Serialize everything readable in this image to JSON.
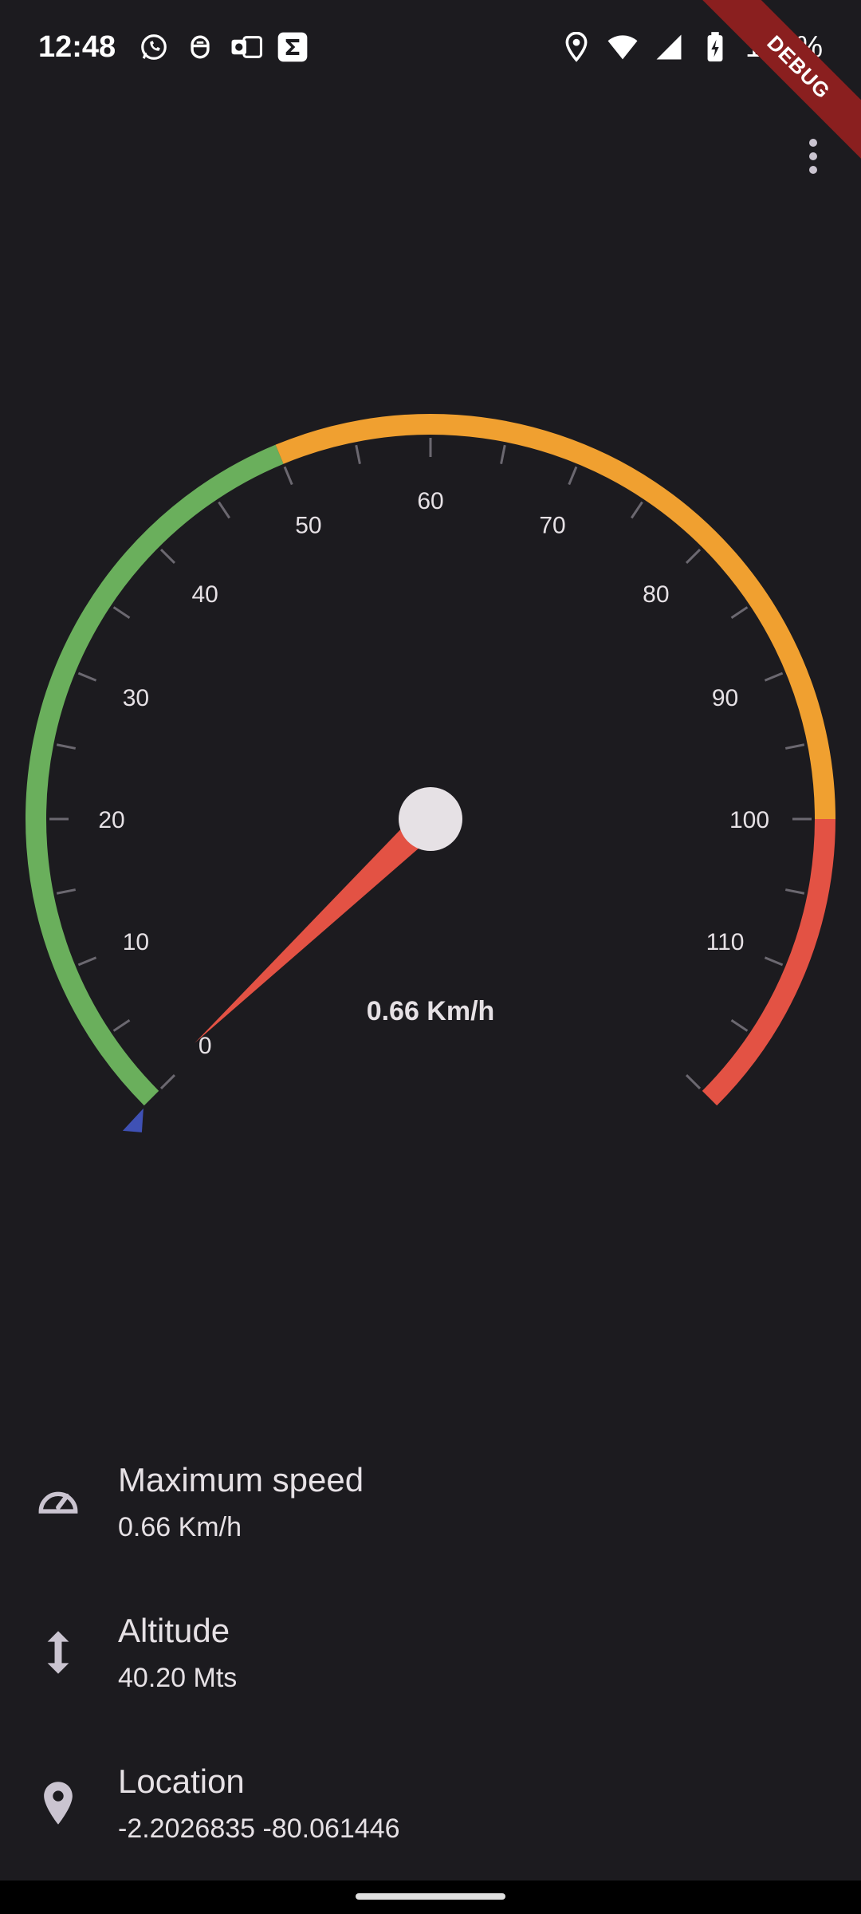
{
  "status_bar": {
    "time": "12:48",
    "battery": "100%",
    "left_icons": [
      "whatsapp-icon",
      "bug-icon",
      "vpn-icon",
      "sigma-icon"
    ],
    "right_icons": [
      "location-icon",
      "wifi-icon",
      "signal-icon",
      "battery-charging-icon"
    ]
  },
  "debug_banner": "DEBUG",
  "speedometer": {
    "min": 0,
    "max": 120,
    "value": 0.66,
    "readout": "0.66 Km/h",
    "tick_labels": [
      "0",
      "10",
      "20",
      "30",
      "40",
      "50",
      "60",
      "70",
      "80",
      "90",
      "100",
      "110"
    ],
    "ranges": [
      {
        "from": 0,
        "to": 50,
        "color": "#6aaf5c"
      },
      {
        "from": 50,
        "to": 100,
        "color": "#f0a030"
      },
      {
        "from": 100,
        "to": 120,
        "color": "#e35244"
      }
    ],
    "needle_color": "#e35244",
    "hub_color": "#e6e1e5",
    "marker_color": "#3f51b5"
  },
  "info": {
    "max_speed": {
      "title": "Maximum speed",
      "value": "0.66 Km/h",
      "icon": "speedometer-icon"
    },
    "altitude": {
      "title": "Altitude",
      "value": "40.20 Mts",
      "icon": "vertical-arrows-icon"
    },
    "location": {
      "title": "Location",
      "value": "-2.2026835 -80.061446",
      "icon": "location-pin-icon"
    }
  }
}
